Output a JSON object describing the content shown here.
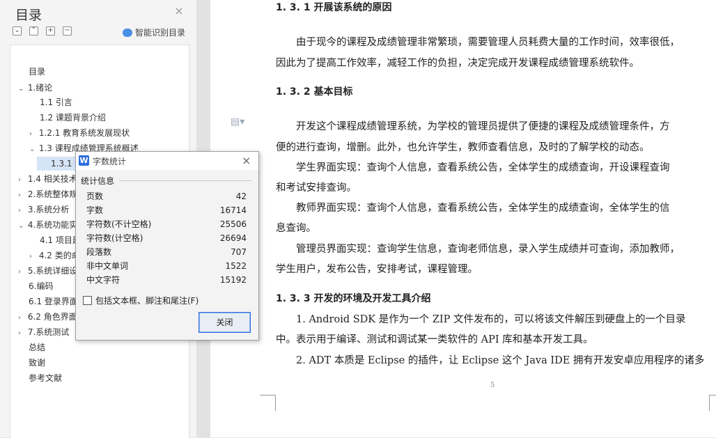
{
  "toc": {
    "title": "目录",
    "smart_toc_label": "智能识别目录",
    "toolbar_icons": [
      "collapse-all-icon",
      "expand-all-icon",
      "add-heading-icon",
      "remove-heading-icon"
    ],
    "items": [
      {
        "label": "目录",
        "chevron": ""
      },
      {
        "label": "1.绪论",
        "chevron": "v"
      },
      {
        "label": "1.1 引言",
        "chevron": ""
      },
      {
        "label": "1.2 课题背景介绍",
        "chevron": ""
      },
      {
        "label": "1.2.1 教育系统发展现状",
        "chevron": ">"
      },
      {
        "label": "1.3 课程成绩管理系统概述",
        "chevron": "v"
      },
      {
        "label": "1.3.1 开",
        "chevron": ""
      },
      {
        "label": "1.4 相关技术",
        "chevron": ">"
      },
      {
        "label": "2.系统整体规",
        "chevron": ">"
      },
      {
        "label": "3.系统分析",
        "chevron": ">"
      },
      {
        "label": "4.系统功能实",
        "chevron": "v"
      },
      {
        "label": "4.1 项目建",
        "chevron": ""
      },
      {
        "label": "4.2 类的命",
        "chevron": ">"
      },
      {
        "label": "5.系统详细设",
        "chevron": ">"
      },
      {
        "label": "6.编码",
        "chevron": ""
      },
      {
        "label": "6.1 登录界面",
        "chevron": ""
      },
      {
        "label": "6.2 角色界面",
        "chevron": ">"
      },
      {
        "label": "7.系统测试",
        "chevron": ">"
      },
      {
        "label": "总结",
        "chevron": ""
      },
      {
        "label": "致谢",
        "chevron": ""
      },
      {
        "label": "参考文献",
        "chevron": ""
      }
    ]
  },
  "document": {
    "headings": [
      "1. 3. 1  开展该系统的原因",
      "1. 3. 2  基本目标",
      "1. 3. 3  开发的环境及开发工具介绍"
    ],
    "lines": [
      "由于现今的课程及成绩管理非常繁琐，需要管理人员耗费大量的工作时间，效率很低，",
      "因此为了提高工作效率，减轻工作的负担，决定完成开发课程成绩管理系统软件。",
      "开发这个课程成绩管理系统，为学校的管理员提供了便捷的课程及成绩管理条件，方",
      "便的进行查询，增删。此外，也允许学生，教师查看信息，及时的了解学校的动态。",
      "学生界面实现：查询个人信息，查看系统公告，全体学生的成绩查询，开设课程查询",
      "和考试安排查询。",
      "教师界面实现：查询个人信息，查看系统公告，全体学生的成绩查询，全体学生的信",
      "息查询。",
      "管理员界面实现：查询学生信息，查询老师信息，录入学生成绩并可查询，添加教师，",
      "学生用户，发布公告，安排考试，课程管理。",
      "1. Android SDK 是作为一个 ZIP 文件发布的，可以将该文件解压到硬盘上的一个目录",
      "中。表示用于编译、测试和调试某一类软件的 API 库和基本开发工具。",
      "2. ADT 本质是 Eclipse 的插件，让 Eclipse 这个 Java IDE 拥有开发安卓应用程序的诸多"
    ],
    "page_number": "5"
  },
  "word_count": {
    "app_icon": "W",
    "title": "字数统计",
    "section_label": "统计信息",
    "rows": [
      {
        "label": "页数",
        "value": "42"
      },
      {
        "label": "字数",
        "value": "16714"
      },
      {
        "label": "字符数(不计空格)",
        "value": "25506"
      },
      {
        "label": "字符数(计空格)",
        "value": "26694"
      },
      {
        "label": "段落数",
        "value": "707"
      },
      {
        "label": "非中文单词",
        "value": "1522"
      },
      {
        "label": "中文字符",
        "value": "15192"
      }
    ],
    "include_label": "包括文本框、脚注和尾注(F)",
    "close_label": "关闭"
  },
  "colors": {
    "accent": "#2f6fde",
    "toc_selected": "#d6e4f7"
  }
}
